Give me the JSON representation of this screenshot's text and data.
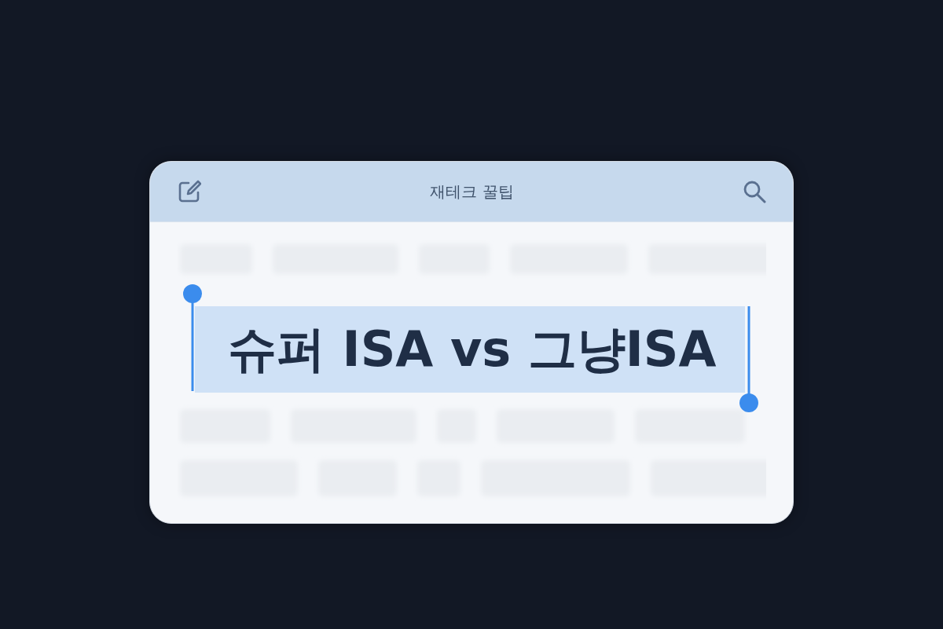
{
  "header": {
    "title": "재테크 꿀팁"
  },
  "selection": {
    "text": "슈퍼 ISA vs 그냥ISA"
  }
}
